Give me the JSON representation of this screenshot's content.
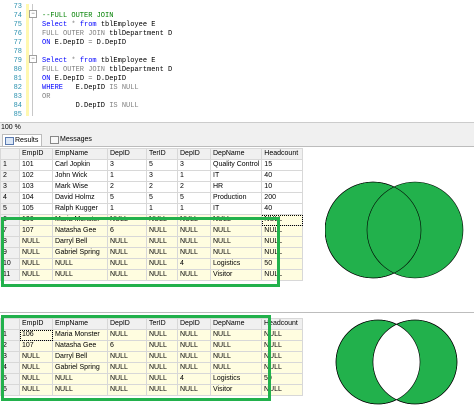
{
  "editor": {
    "line_numbers": [
      "73",
      "74",
      "75",
      "76",
      "77",
      "78",
      "79",
      "80",
      "81",
      "82",
      "83",
      "84",
      "85"
    ],
    "lines": [
      [
        {
          "t": "",
          "c": ""
        }
      ],
      [
        {
          "t": "--FULL OUTER JOIN",
          "c": "cm"
        }
      ],
      [
        {
          "t": "Select ",
          "c": "kw"
        },
        {
          "t": "* ",
          "c": "gr"
        },
        {
          "t": "from ",
          "c": "kw"
        },
        {
          "t": "tblEmployee E",
          "c": ""
        }
      ],
      [
        {
          "t": "FULL OUTER JOIN ",
          "c": "gr"
        },
        {
          "t": "tblDepartment D",
          "c": ""
        }
      ],
      [
        {
          "t": "ON ",
          "c": "kw"
        },
        {
          "t": "E.DepID ",
          "c": ""
        },
        {
          "t": "= ",
          "c": "gr"
        },
        {
          "t": "D.DepID",
          "c": ""
        }
      ],
      [
        {
          "t": "",
          "c": ""
        }
      ],
      [
        {
          "t": "Select ",
          "c": "kw"
        },
        {
          "t": "* ",
          "c": "gr"
        },
        {
          "t": "from ",
          "c": "kw"
        },
        {
          "t": "tblEmployee E",
          "c": ""
        }
      ],
      [
        {
          "t": "FULL OUTER JOIN ",
          "c": "gr"
        },
        {
          "t": "tblDepartment D",
          "c": ""
        }
      ],
      [
        {
          "t": "ON ",
          "c": "kw"
        },
        {
          "t": "E.DepID ",
          "c": ""
        },
        {
          "t": "= ",
          "c": "gr"
        },
        {
          "t": "D.DepID",
          "c": ""
        }
      ],
      [
        {
          "t": "WHERE   ",
          "c": "kw"
        },
        {
          "t": "E.DepID ",
          "c": ""
        },
        {
          "t": "IS NULL",
          "c": "gr"
        }
      ],
      [
        {
          "t": "OR",
          "c": "gr"
        }
      ],
      [
        {
          "t": "        D.DepID ",
          "c": ""
        },
        {
          "t": "IS NULL",
          "c": "gr"
        }
      ],
      [
        {
          "t": "",
          "c": ""
        }
      ]
    ]
  },
  "status": {
    "zoom": "100 %"
  },
  "tabs": {
    "results": "Results",
    "messages": "Messages"
  },
  "columns": [
    "EmpID",
    "EmpName",
    "DepID",
    "TerID",
    "DepID",
    "DepName",
    "Headcount"
  ],
  "grid1": [
    [
      "1",
      "101",
      "Carl Jopkin",
      "3",
      "5",
      "3",
      "Quality Control",
      "15"
    ],
    [
      "2",
      "102",
      "John Wick",
      "1",
      "3",
      "1",
      "IT",
      "40"
    ],
    [
      "3",
      "103",
      "Mark Wise",
      "2",
      "2",
      "2",
      "HR",
      "10"
    ],
    [
      "4",
      "104",
      "David Holmz",
      "5",
      "5",
      "5",
      "Production",
      "200"
    ],
    [
      "5",
      "105",
      "Ralph Kugger",
      "1",
      "1",
      "1",
      "IT",
      "40"
    ],
    [
      "6",
      "106",
      "Maria Monster",
      "NULL",
      "NULL",
      "NULL",
      "NULL",
      "NULL"
    ],
    [
      "7",
      "107",
      "Natasha Gee",
      "6",
      "NULL",
      "NULL",
      "NULL",
      "NULL"
    ],
    [
      "8",
      "NULL",
      "Darryl Bell",
      "NULL",
      "NULL",
      "NULL",
      "NULL",
      "NULL"
    ],
    [
      "9",
      "NULL",
      "Gabriel Spring",
      "NULL",
      "NULL",
      "NULL",
      "NULL",
      "NULL"
    ],
    [
      "10",
      "NULL",
      "NULL",
      "NULL",
      "NULL",
      "4",
      "Logistics",
      "50"
    ],
    [
      "11",
      "NULL",
      "NULL",
      "NULL",
      "NULL",
      "NULL",
      "Visitor",
      "NULL"
    ]
  ],
  "grid2": [
    [
      "1",
      "106",
      "Maria Monster",
      "NULL",
      "NULL",
      "NULL",
      "NULL",
      "NULL"
    ],
    [
      "2",
      "107",
      "Natasha Gee",
      "6",
      "NULL",
      "NULL",
      "NULL",
      "NULL"
    ],
    [
      "3",
      "NULL",
      "Darryl Bell",
      "NULL",
      "NULL",
      "NULL",
      "NULL",
      "NULL"
    ],
    [
      "4",
      "NULL",
      "Gabriel Spring",
      "NULL",
      "NULL",
      "NULL",
      "NULL",
      "NULL"
    ],
    [
      "5",
      "NULL",
      "NULL",
      "NULL",
      "NULL",
      "4",
      "Logistics",
      "50"
    ],
    [
      "6",
      "NULL",
      "NULL",
      "NULL",
      "NULL",
      "NULL",
      "Visitor",
      "NULL"
    ]
  ],
  "colors": {
    "venn_green": "#22b14c",
    "highlight_border": "#22b14c",
    "row_highlight": "#fffde0"
  }
}
